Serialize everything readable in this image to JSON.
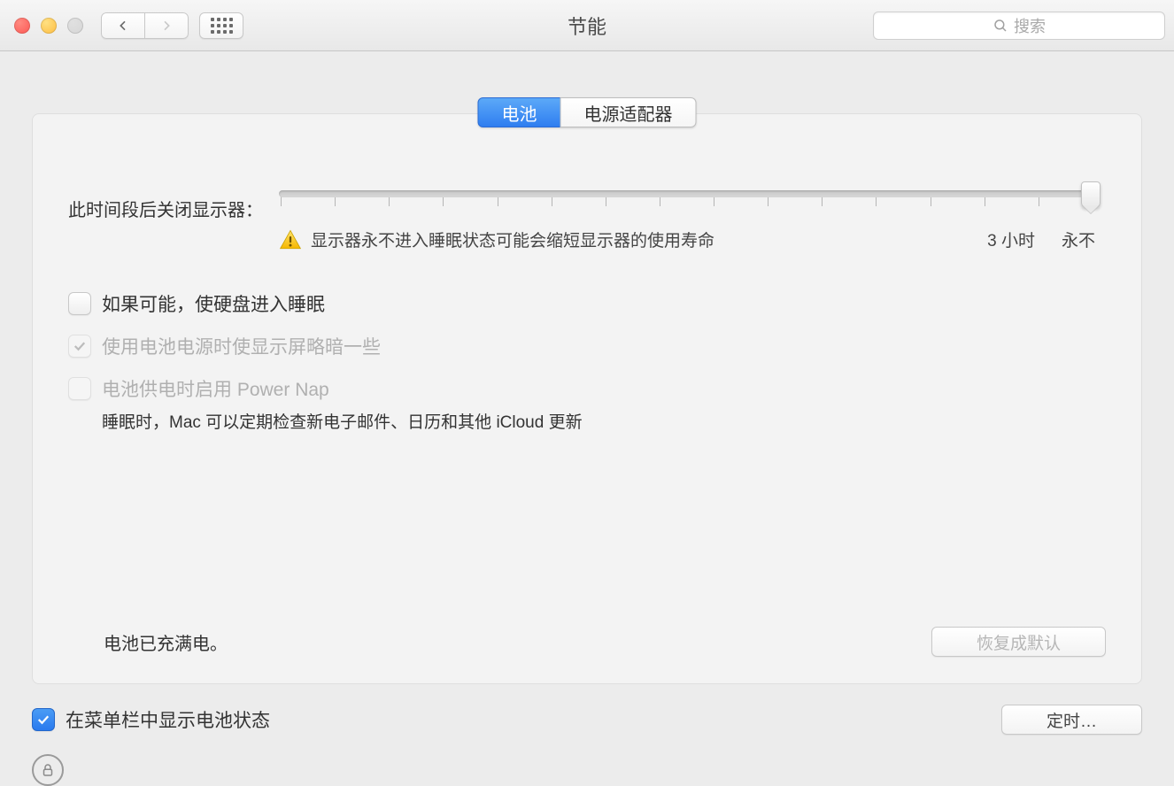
{
  "window": {
    "title": "节能"
  },
  "search": {
    "placeholder": "搜索"
  },
  "tabs": {
    "battery": "电池",
    "adapter": "电源适配器",
    "active": "battery"
  },
  "slider": {
    "label": "此时间段后关闭显示器：",
    "warning": "显示器永不进入睡眠状态可能会缩短显示器的使用寿命",
    "tick_3h": "3 小时",
    "tick_never": "永不"
  },
  "checks": {
    "hdd_sleep": {
      "label": "如果可能，使硬盘进入睡眠",
      "checked": false,
      "enabled": true
    },
    "dim_display": {
      "label": "使用电池电源时使显示屏略暗一些",
      "checked": true,
      "enabled": false
    },
    "power_nap": {
      "label": "电池供电时启用 Power Nap",
      "checked": false,
      "enabled": false,
      "sub": "睡眠时，Mac 可以定期检查新电子邮件、日历和其他 iCloud 更新"
    }
  },
  "status": {
    "battery_full": "电池已充满电。"
  },
  "buttons": {
    "restore_defaults": "恢复成默认",
    "schedule": "定时…"
  },
  "footer": {
    "show_in_menubar": {
      "label": "在菜单栏中显示电池状态",
      "checked": true
    }
  }
}
